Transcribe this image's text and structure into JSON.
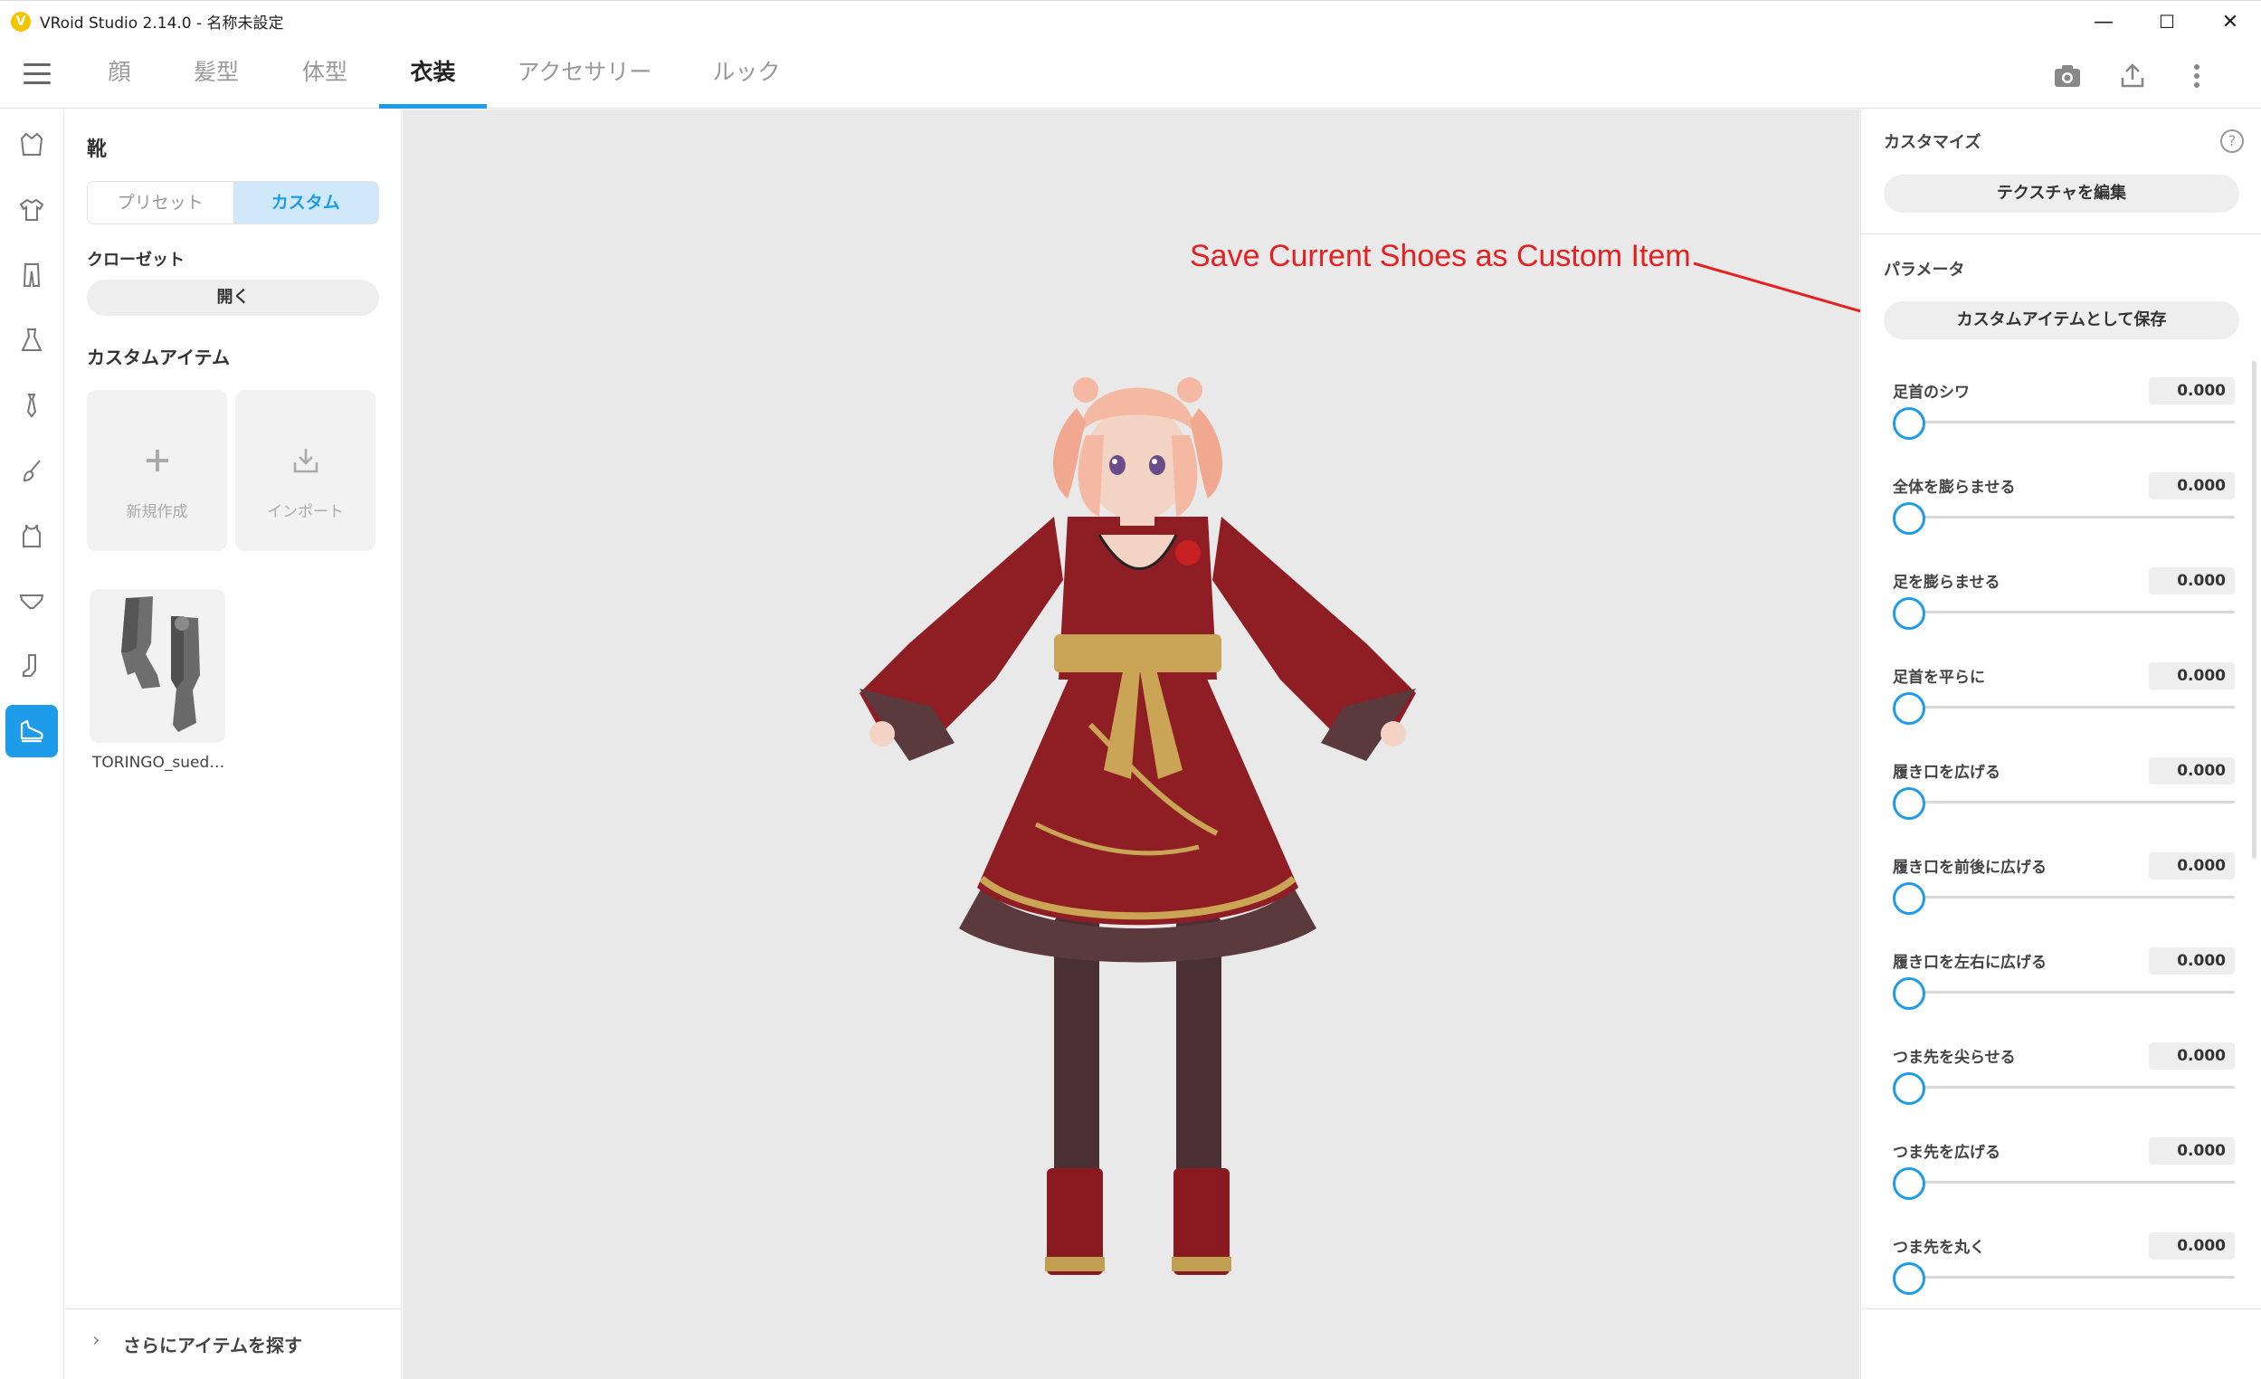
{
  "window": {
    "title": "VRoid Studio 2.14.0 - 名称未設定",
    "minimize": "—",
    "maximize": "☐",
    "close": "✕"
  },
  "menu": {
    "tabs": [
      {
        "label": "顔"
      },
      {
        "label": "髪型"
      },
      {
        "label": "体型"
      },
      {
        "label": "衣装"
      },
      {
        "label": "アクセサリー"
      },
      {
        "label": "ルック"
      }
    ],
    "active_tab": "衣装"
  },
  "left_panel": {
    "title": "靴",
    "segment": {
      "preset": "プリセット",
      "custom": "カスタム",
      "selected": "カスタム"
    },
    "closet_label": "クローゼット",
    "closet_open": "開く",
    "custom_items_label": "カスタムアイテム",
    "new_label": "新規作成",
    "import_label": "インポート",
    "item_name": "TORINGO_sued…",
    "more_items": "さらにアイテムを探す"
  },
  "annotation": "Save Current Shoes as Custom Item",
  "right_panel": {
    "customize_label": "カスタマイズ",
    "edit_texture": "テクスチャを編集",
    "parameters_label": "パラメータ",
    "save_custom": "カスタムアイテムとして保存",
    "params": [
      {
        "label": "足首のシワ",
        "value": "0.000"
      },
      {
        "label": "全体を膨らませる",
        "value": "0.000"
      },
      {
        "label": "足を膨らませる",
        "value": "0.000"
      },
      {
        "label": "足首を平らに",
        "value": "0.000"
      },
      {
        "label": "履き口を広げる",
        "value": "0.000"
      },
      {
        "label": "履き口を前後に広げる",
        "value": "0.000"
      },
      {
        "label": "履き口を左右に広げる",
        "value": "0.000"
      },
      {
        "label": "つま先を尖らせる",
        "value": "0.000"
      },
      {
        "label": "つま先を広げる",
        "value": "0.000"
      },
      {
        "label": "つま先を丸く",
        "value": "0.000"
      }
    ]
  },
  "colors": {
    "accent": "#1e9be9",
    "annotation": "#e52020",
    "viewport_bg": "#e9e9e9"
  }
}
